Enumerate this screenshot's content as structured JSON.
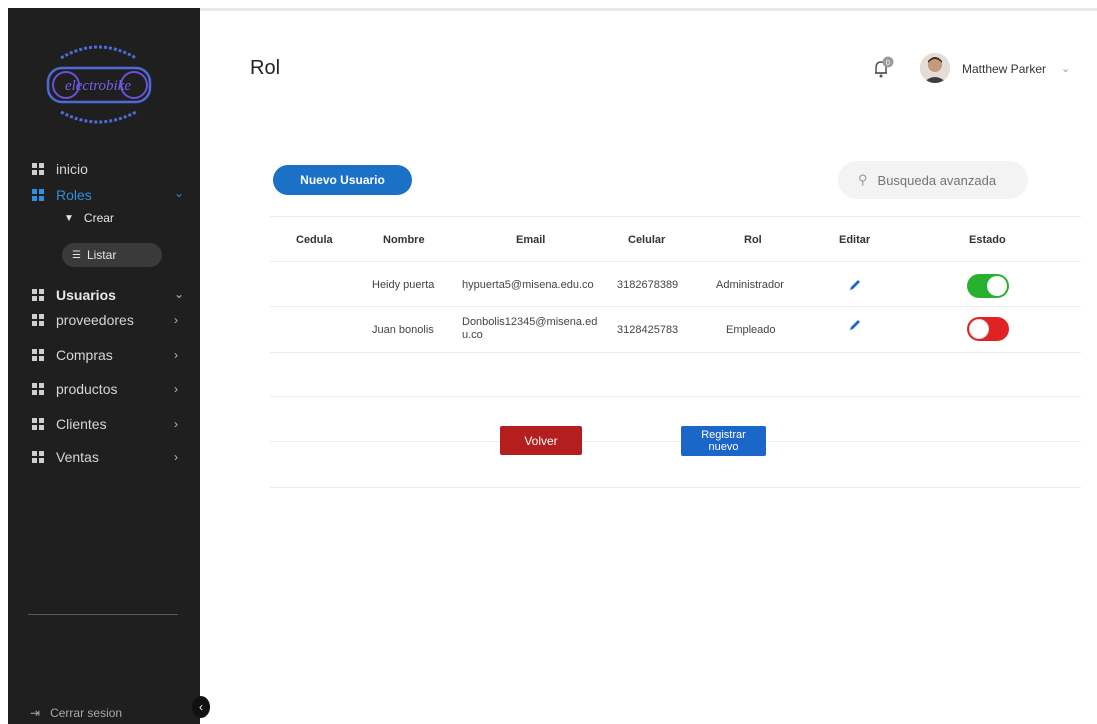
{
  "brand": {
    "logo_text": "electrobike"
  },
  "sidebar": {
    "items": [
      {
        "label": "inicio"
      },
      {
        "label": "Roles"
      },
      {
        "label": "Usuarios"
      },
      {
        "label": "proveedores"
      },
      {
        "label": "Compras"
      },
      {
        "label": "productos"
      },
      {
        "label": "Clientes"
      },
      {
        "label": "Ventas"
      }
    ],
    "sub_items": [
      {
        "label": "Crear",
        "icon": "filter-icon"
      },
      {
        "label": "Listar",
        "icon": "list-icon"
      }
    ],
    "logout_label": "Cerrar sesion",
    "active_color": "#2f8fe0"
  },
  "header": {
    "title": "Rol",
    "notification_count": "0",
    "user_name": "Matthew Parker"
  },
  "toolbar": {
    "new_label": "Nuevo Usuario",
    "search_placeholder": "Busqueda avanzada"
  },
  "table": {
    "columns": [
      "Cedula",
      "Nombre",
      "Email",
      "Celular",
      "Rol",
      "Editar",
      "Estado"
    ],
    "rows": [
      {
        "cedula": "",
        "nombre": "Heidy puerta",
        "email": "hypuerta5@misena.edu.co",
        "celular": "3182678389",
        "rol": "Administrador",
        "estado": "on"
      },
      {
        "cedula": "",
        "nombre": "Juan bonolis",
        "email": "Donbolis12345@misena.edu.co",
        "celular": "3128425783",
        "rol": "Empleado",
        "estado": "off"
      }
    ]
  },
  "actions": {
    "back_label": "Volver",
    "register_label": "Registrar nuevo"
  },
  "colors": {
    "toggle_on": "#27b12f",
    "toggle_off": "#e02222",
    "primary": "#1b71c5",
    "danger": "#b51e1e"
  }
}
